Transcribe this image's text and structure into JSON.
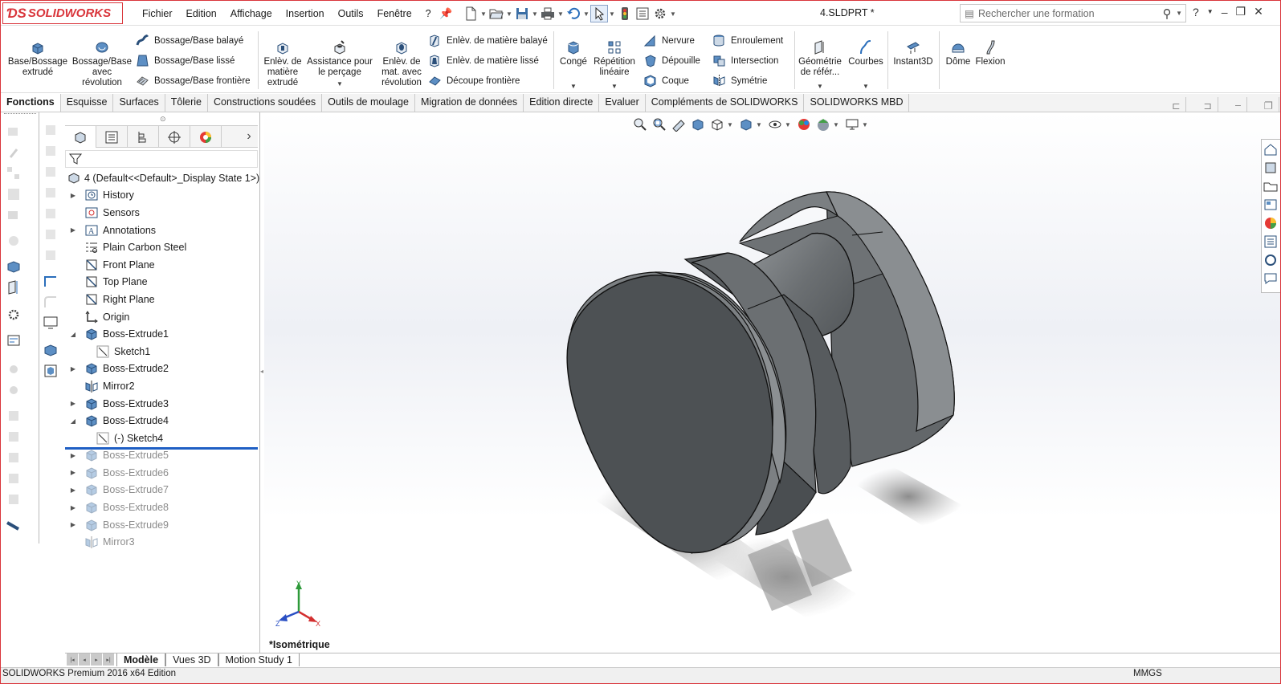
{
  "app": {
    "logo": "SOLIDWORKS",
    "document_title": "4.SLDPRT *"
  },
  "menu": [
    "Fichier",
    "Edition",
    "Affichage",
    "Insertion",
    "Outils",
    "Fenêtre",
    "?"
  ],
  "search": {
    "placeholder": "Rechercher une formation"
  },
  "title_controls": {
    "help": "?"
  },
  "ribbon": {
    "boss_extrude": "Base/Bossage extrudé",
    "boss_revolve": "Bossage/Base avec révolution",
    "boss_sweep": "Bossage/Base balayé",
    "boss_loft": "Bossage/Base lissé",
    "boss_boundary": "Bossage/Base frontière",
    "cut_extrude": "Enlèv. de matière extrudé",
    "hole_wizard": "Assistance pour le perçage",
    "cut_revolve": "Enlèv. de mat. avec révolution",
    "cut_sweep": "Enlèv. de matière balayé",
    "cut_loft": "Enlèv. de matière lissé",
    "cut_boundary": "Découpe frontière",
    "fillet": "Congé",
    "linear_pattern": "Répétition linéaire",
    "rib": "Nervure",
    "draft": "Dépouille",
    "shell": "Coque",
    "wrap": "Enroulement",
    "intersect": "Intersection",
    "mirror": "Symétrie",
    "ref_geometry": "Géométrie de référ...",
    "curves": "Courbes",
    "instant3d": "Instant3D",
    "dome": "Dôme",
    "flex": "Flexion"
  },
  "command_tabs": [
    {
      "label": "Fonctions",
      "active": true
    },
    {
      "label": "Esquisse"
    },
    {
      "label": "Surfaces"
    },
    {
      "label": "Tôlerie"
    },
    {
      "label": "Constructions soudées"
    },
    {
      "label": "Outils de moulage"
    },
    {
      "label": "Migration de données"
    },
    {
      "label": "Edition directe"
    },
    {
      "label": "Evaluer"
    },
    {
      "label": "Compléments de SOLIDWORKS"
    },
    {
      "label": "SOLIDWORKS MBD"
    }
  ],
  "feature_tree": {
    "root": "4  (Default<<Default>_Display State 1>)",
    "items": [
      {
        "label": "History",
        "icon": "history-icon",
        "expandable": true
      },
      {
        "label": "Sensors",
        "icon": "sensors-icon"
      },
      {
        "label": "Annotations",
        "icon": "annotations-icon",
        "expandable": true
      },
      {
        "label": "Plain Carbon Steel",
        "icon": "material-icon"
      },
      {
        "label": "Front Plane",
        "icon": "plane-icon"
      },
      {
        "label": "Top Plane",
        "icon": "plane-icon"
      },
      {
        "label": "Right Plane",
        "icon": "plane-icon"
      },
      {
        "label": "Origin",
        "icon": "origin-icon"
      },
      {
        "label": "Boss-Extrude1",
        "icon": "extrude-icon",
        "expanded": true
      },
      {
        "label": "Sketch1",
        "icon": "sketch-icon",
        "indent": true
      },
      {
        "label": "Boss-Extrude2",
        "icon": "extrude-icon",
        "expandable": true
      },
      {
        "label": "Mirror2",
        "icon": "mirror-icon"
      },
      {
        "label": "Boss-Extrude3",
        "icon": "extrude-icon",
        "expandable": true
      },
      {
        "label": "Boss-Extrude4",
        "icon": "extrude-icon",
        "expanded": true
      },
      {
        "label": "(-) Sketch4",
        "icon": "sketch-icon",
        "indent": true
      },
      {
        "label": "Boss-Extrude5",
        "icon": "extrude-icon",
        "expandable": true,
        "suppressed": true
      },
      {
        "label": "Boss-Extrude6",
        "icon": "extrude-icon",
        "expandable": true,
        "suppressed": true
      },
      {
        "label": "Boss-Extrude7",
        "icon": "extrude-icon",
        "expandable": true,
        "suppressed": true
      },
      {
        "label": "Boss-Extrude8",
        "icon": "extrude-icon",
        "expandable": true,
        "suppressed": true
      },
      {
        "label": "Boss-Extrude9",
        "icon": "extrude-icon",
        "expandable": true,
        "suppressed": true
      },
      {
        "label": "Mirror3",
        "icon": "mirror-icon",
        "suppressed": true
      }
    ]
  },
  "viewport": {
    "view_name": "*Isométrique",
    "triad": {
      "x": "X",
      "y": "Y",
      "z": "Z"
    }
  },
  "bottom_tabs": [
    {
      "label": "Modèle",
      "active": true
    },
    {
      "label": "Vues 3D"
    },
    {
      "label": "Motion Study 1"
    }
  ],
  "status": {
    "left": "SOLIDWORKS Premium 2016 x64 Edition",
    "right": "MMGS"
  },
  "colors": {
    "brand": "#d9353b",
    "accent": "#1f5fc4",
    "model": "#5b5f62"
  }
}
